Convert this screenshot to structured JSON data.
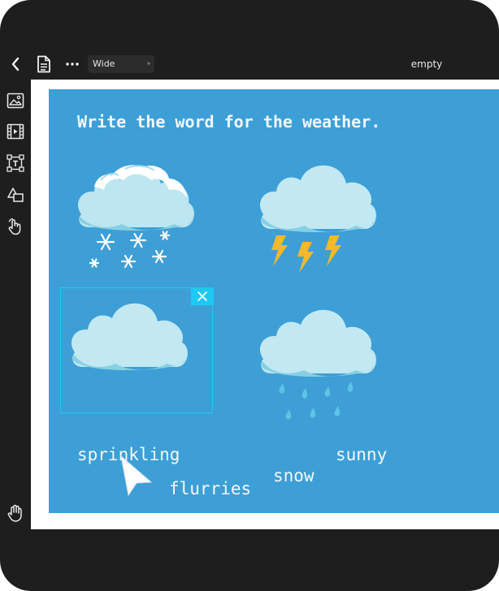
{
  "toolbar": {
    "layout_select": "Wide",
    "document_title": "empty"
  },
  "slide": {
    "title": "Write the word for the weather.",
    "pictures": [
      {
        "icon": "snow-cloud-icon"
      },
      {
        "icon": "thunderstorm-cloud-icon"
      },
      {
        "icon": "cloud-icon",
        "selected": true
      },
      {
        "icon": "rain-cloud-icon"
      }
    ],
    "words": [
      "sprinkling",
      "sunny",
      "snow",
      "flurries"
    ]
  },
  "colors": {
    "frame": "#1e1e1e",
    "slide_background": "#3d9fd6",
    "selection": "#1ec8f3",
    "cloud": "#c2e8f2",
    "cloud_shadow": "#7ecbe0",
    "lightning": "#f5b92a",
    "raindrop": "#5ec4e6"
  }
}
